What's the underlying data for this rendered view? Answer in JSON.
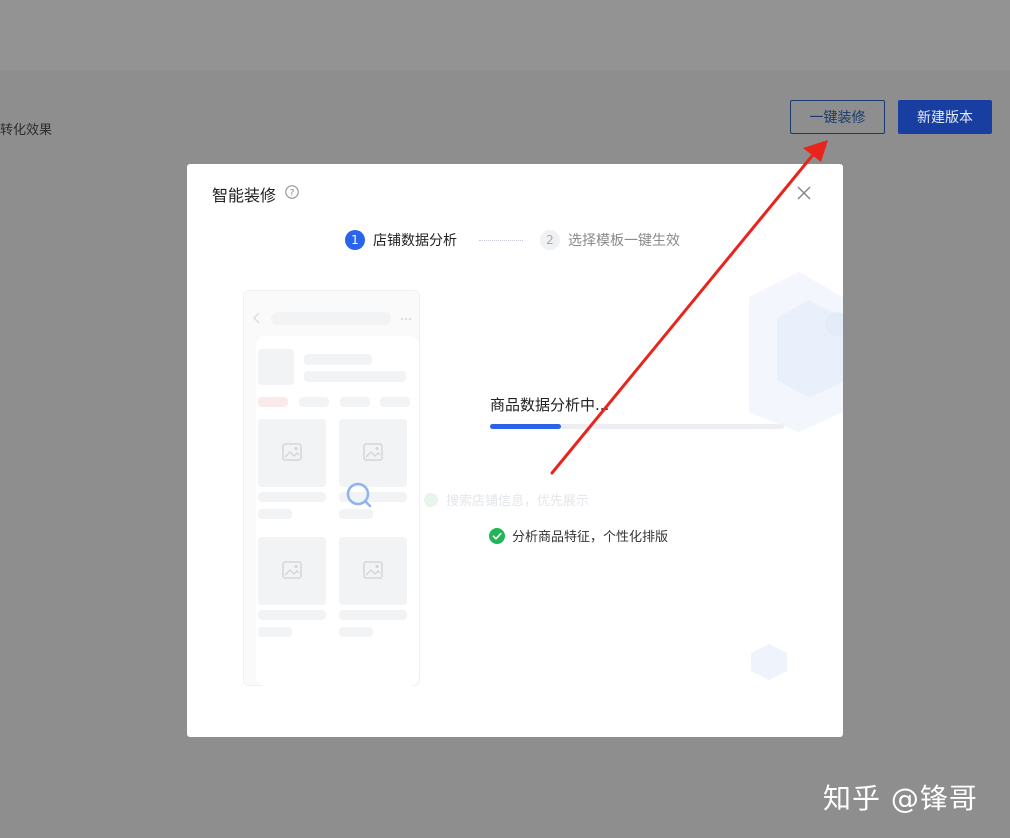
{
  "background": {
    "partial_text": "转化效果",
    "buttons": {
      "one_click_decorate": "一键装修",
      "new_version": "新建版本"
    }
  },
  "modal": {
    "title": "智能装修",
    "steps": [
      {
        "number": "1",
        "label": "店铺数据分析",
        "state": "active"
      },
      {
        "number": "2",
        "label": "选择模板一键生效",
        "state": "pending"
      }
    ],
    "status_text": "商品数据分析中...",
    "progress": 0.24,
    "ghost_item": "搜索店铺信息，优先展示",
    "check_item": "分析商品特征，个性化排版"
  },
  "watermark": "知乎 @锋哥",
  "colors": {
    "primary": "#2a64e8",
    "button_blue": "#173ea0",
    "success": "#22b557",
    "annotation_arrow": "#e8241c"
  }
}
